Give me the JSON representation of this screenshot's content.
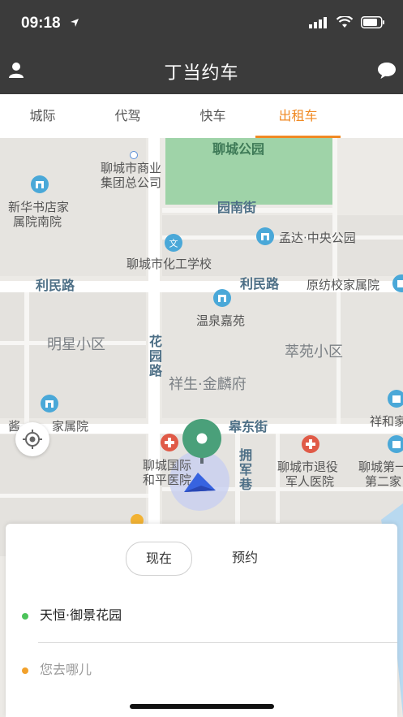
{
  "status_bar": {
    "time": "09:18"
  },
  "header": {
    "title": "丁当约车"
  },
  "tabs": [
    {
      "label": "城际",
      "active": false
    },
    {
      "label": "代驾",
      "active": false
    },
    {
      "label": "快车",
      "active": false
    },
    {
      "label": "出租车",
      "active": true
    }
  ],
  "map": {
    "labels": {
      "park": "聊城公园",
      "shangye_line1": "聊城市商业",
      "shangye_line2": "集团总公司",
      "xinhua_line1": "新华书店家",
      "xinhua_line2": "属院南院",
      "yuannan_street": "园南街",
      "mengda": "孟达·中央公园",
      "huagong": "聊城市化工学校",
      "limin_road_left": "利民路",
      "limin_road_right": "利民路",
      "yuanfang": "原纺校家属院",
      "wenquan": "温泉嘉苑",
      "mingxing": "明星小区",
      "huayuan_road": "花园路",
      "cuiyuan": "萃苑小区",
      "xiangsheng": "祥生·金麟府",
      "jiashuyuan_left": "酱",
      "jiashuyuan_right": "家属院",
      "gaodong_street": "皋东街",
      "xianghejia": "祥和家",
      "guoji_line1": "聊城国际",
      "guoji_line2": "和平医院",
      "yongjun_lane": "拥军巷",
      "tuiyi_line1": "聊城市退役",
      "tuiyi_line2": "军人医院",
      "diyi_line1": "聊城第一",
      "diyi_line2": "第二家"
    }
  },
  "panel": {
    "now_label": "现在",
    "reserve_label": "预约",
    "pickup": "天恒·御景花园",
    "destination_placeholder": "您去哪儿",
    "colors": {
      "pickup_dot": "#4cc35a",
      "destination_dot": "#f2a12b",
      "accent": "#f08a24"
    }
  }
}
